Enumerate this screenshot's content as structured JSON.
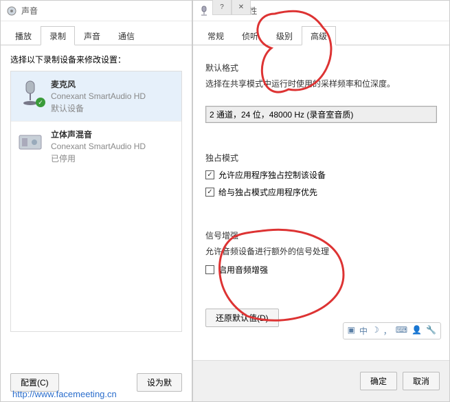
{
  "sound_window": {
    "title": "声音",
    "tabs": [
      "播放",
      "录制",
      "声音",
      "通信"
    ],
    "active_tab_index": 1,
    "instruction": "选择以下录制设备来修改设置：",
    "devices": [
      {
        "name": "麦克风",
        "sub": "Conexant SmartAudio HD",
        "status": "默认设备",
        "default": true,
        "enabled": true
      },
      {
        "name": "立体声混音",
        "sub": "Conexant SmartAudio HD",
        "status": "已停用",
        "default": false,
        "enabled": false
      }
    ],
    "configure_btn": "配置(C)",
    "set_default_btn": "设为默"
  },
  "prop_window": {
    "title": "麦克风 属性",
    "tabs": [
      "常规",
      "侦听",
      "级别",
      "高级"
    ],
    "active_tab_index": 3,
    "groups": {
      "default_format": {
        "title": "默认格式",
        "desc": "选择在共享模式中运行时使用的采样频率和位深度。",
        "selected": "2 通道，24 位，48000 Hz (录音室音质)"
      },
      "exclusive": {
        "title": "独占模式",
        "cb1": {
          "label": "允许应用程序独占控制该设备",
          "checked": true
        },
        "cb2": {
          "label": "给与独占模式应用程序优先",
          "checked": true
        }
      },
      "signal": {
        "title": "信号增强",
        "desc": "允许音频设备进行额外的信号处理",
        "cb": {
          "label": "启用音频增强",
          "checked": false
        }
      }
    },
    "restore_btn": "还原默认值(D)",
    "ok_btn": "确定",
    "cancel_btn": "取消"
  },
  "ime_bar": [
    "中"
  ],
  "watermark": "http://www.facemeeting.cn"
}
